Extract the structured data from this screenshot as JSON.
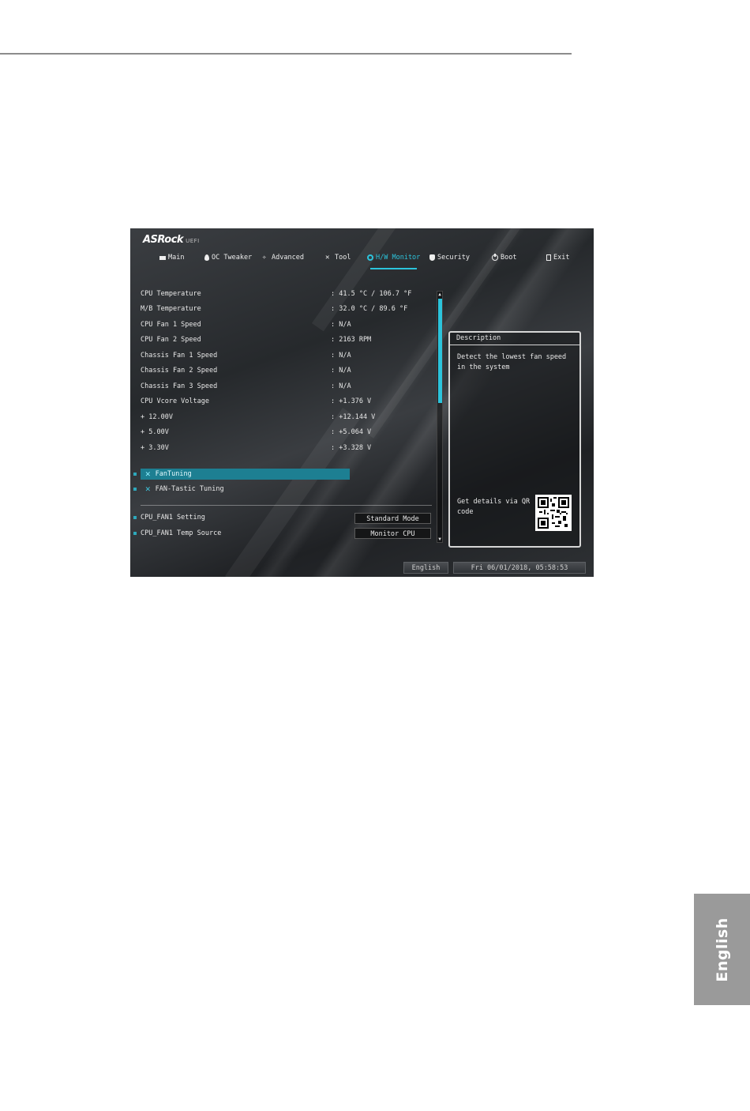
{
  "page": {
    "language_tab": "English"
  },
  "bios": {
    "brand": "ASRock",
    "brand_suffix": "UEFI",
    "tabs": [
      {
        "label": "Main",
        "icon": "list-icon",
        "active": false
      },
      {
        "label": "OC Tweaker",
        "icon": "flame-icon",
        "active": false
      },
      {
        "label": "Advanced",
        "icon": "star-icon",
        "active": false
      },
      {
        "label": "Tool",
        "icon": "tool-icon",
        "active": false
      },
      {
        "label": "H/W Monitor",
        "icon": "gear-icon",
        "active": true
      },
      {
        "label": "Security",
        "icon": "shield-icon",
        "active": false
      },
      {
        "label": "Boot",
        "icon": "power-icon",
        "active": false
      },
      {
        "label": "Exit",
        "icon": "exit-icon",
        "active": false
      }
    ],
    "readings": [
      {
        "label": "CPU Temperature",
        "value": ": 41.5 °C / 106.7 °F"
      },
      {
        "label": "M/B Temperature",
        "value": ": 32.0 °C /  89.6 °F"
      },
      {
        "label": "CPU Fan 1 Speed",
        "value": ": N/A"
      },
      {
        "label": "CPU Fan 2 Speed",
        "value": ": 2163 RPM"
      },
      {
        "label": "Chassis Fan 1 Speed",
        "value": ": N/A"
      },
      {
        "label": "Chassis Fan 2 Speed",
        "value": ": N/A"
      },
      {
        "label": "Chassis Fan 3 Speed",
        "value": ": N/A"
      },
      {
        "label": "CPU Vcore Voltage",
        "value": ": +1.376 V"
      },
      {
        "label": "+ 12.00V",
        "value": ": +12.144 V"
      },
      {
        "label": "+ 5.00V",
        "value": ": +5.064 V"
      },
      {
        "label": "+ 3.30V",
        "value": ": +3.328 V"
      }
    ],
    "menu_items": [
      {
        "label": "FanTuning",
        "selected": true
      },
      {
        "label": "FAN-Tastic Tuning",
        "selected": false
      }
    ],
    "settings": [
      {
        "label": "CPU_FAN1 Setting",
        "value": "Standard Mode"
      },
      {
        "label": "CPU_FAN1 Temp Source",
        "value": "Monitor CPU"
      }
    ],
    "description": {
      "title": "Description",
      "text": "Detect the lowest fan speed in the system",
      "qr_text": "Get details via QR code"
    },
    "status_bar": {
      "language": "English",
      "datetime": "Fri 06/01/2018, 05:58:53"
    },
    "accent_color": "#2cc4dc"
  }
}
